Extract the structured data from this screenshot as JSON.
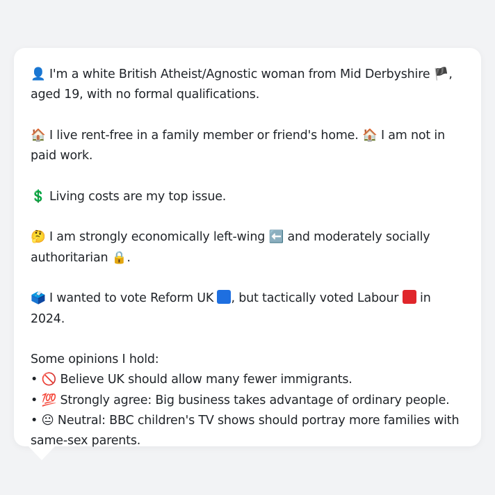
{
  "message": {
    "profile": {
      "icon": "👤",
      "text_a": "I'm a white British Atheist/Agnostic woman from Mid Derbyshire",
      "flag": "🏴",
      "text_b": ", aged 19, with no formal qualifications."
    },
    "housing": {
      "icon1": "🏠",
      "text_a": "I live rent-free in a family member or friend's home.",
      "icon2": "🏠",
      "text_b": "I am not in paid work."
    },
    "issue": {
      "icon": "💲",
      "text": "Living costs are my top issue."
    },
    "politics": {
      "icon": "🤔",
      "text_a": "I am strongly economically left-wing",
      "icon_left": "⬅️",
      "text_b": "and moderately socially authoritarian",
      "icon_lock": "🔒",
      "text_c": "."
    },
    "vote": {
      "icon": "🗳️",
      "text_a": "I wanted to vote Reform UK",
      "reform_color": "#1e6fe0",
      "text_b": ", but tactically voted Labour",
      "labour_color": "#e0262b",
      "text_c": "in 2024."
    },
    "opinions_heading": "Some opinions I hold:",
    "opinions": [
      {
        "bullet": "•",
        "icon": "🚫",
        "text": "Believe UK should allow many fewer immigrants."
      },
      {
        "bullet": "•",
        "icon": "💯",
        "text": "Strongly agree: Big business takes advantage of ordinary people."
      },
      {
        "bullet": "•",
        "icon": "😐",
        "text": "Neutral: BBC children's TV shows should portray more families with same-sex parents."
      }
    ]
  }
}
